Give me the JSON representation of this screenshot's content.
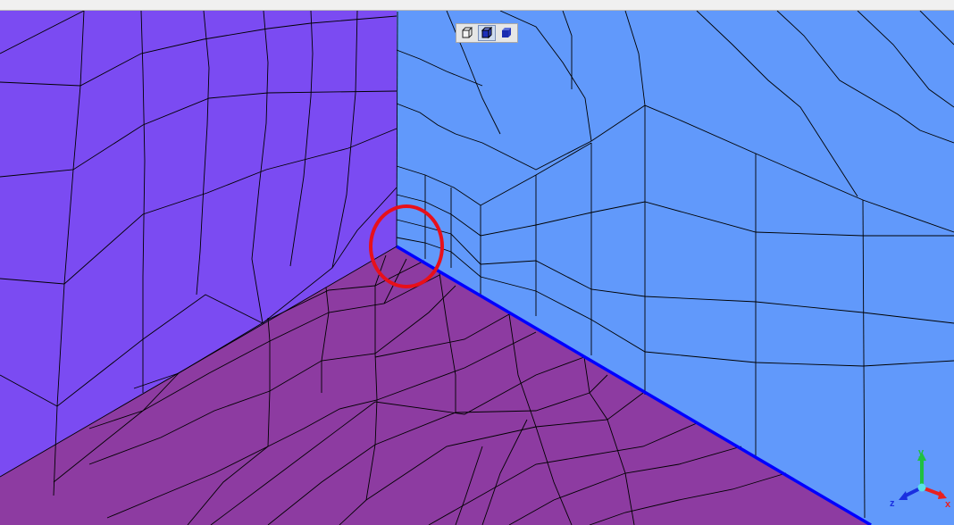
{
  "colors": {
    "left_wall": "#7b4bf2",
    "right_wall": "#6199fb",
    "floor": "#8d3ba1",
    "mesh_line": "#000000",
    "edge_highlight": "#0000ff",
    "marker_circle": "#e8101a",
    "axis_x": "#e82020",
    "axis_y": "#20c040",
    "axis_z": "#1a2fe0"
  },
  "view_toolbar": {
    "buttons": [
      {
        "name": "wireframe",
        "icon": "wireframe-cube-icon",
        "active": false
      },
      {
        "name": "shaded-with-edges",
        "icon": "shaded-edges-cube-icon",
        "active": true
      },
      {
        "name": "shaded",
        "icon": "shaded-cube-icon",
        "active": false
      }
    ]
  },
  "axis_triad": {
    "x_label": "x",
    "y_label": "y",
    "z_label": "z"
  }
}
